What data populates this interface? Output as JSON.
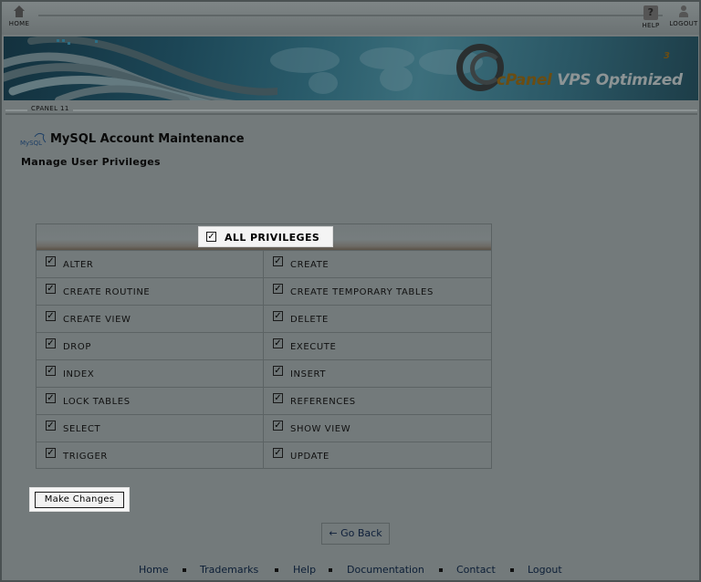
{
  "toolbar": {
    "home_label": "HOME",
    "help_label": "HELP",
    "logout_label": "LOGOUT"
  },
  "banner": {
    "brand_cpanel": "cPanel",
    "brand_rest": " VPS Optimized",
    "brand_version": "3"
  },
  "breadcrumb": {
    "label": "CPANEL 11"
  },
  "page": {
    "logo_text": "MySQL",
    "title": "MySQL Account Maintenance",
    "subtitle": "Manage User Privileges"
  },
  "privileges": {
    "all_label": "ALL PRIVILEGES",
    "all_checked": true,
    "rows": [
      [
        {
          "label": "ALTER",
          "checked": true
        },
        {
          "label": "CREATE",
          "checked": true
        }
      ],
      [
        {
          "label": "CREATE ROUTINE",
          "checked": true
        },
        {
          "label": "CREATE TEMPORARY TABLES",
          "checked": true
        }
      ],
      [
        {
          "label": "CREATE VIEW",
          "checked": true
        },
        {
          "label": "DELETE",
          "checked": true
        }
      ],
      [
        {
          "label": "DROP",
          "checked": true
        },
        {
          "label": "EXECUTE",
          "checked": true
        }
      ],
      [
        {
          "label": "INDEX",
          "checked": true
        },
        {
          "label": "INSERT",
          "checked": true
        }
      ],
      [
        {
          "label": "LOCK TABLES",
          "checked": true
        },
        {
          "label": "REFERENCES",
          "checked": true
        }
      ],
      [
        {
          "label": "SELECT",
          "checked": true
        },
        {
          "label": "SHOW VIEW",
          "checked": true
        }
      ],
      [
        {
          "label": "TRIGGER",
          "checked": true
        },
        {
          "label": "UPDATE",
          "checked": true
        }
      ]
    ]
  },
  "actions": {
    "make_changes_label": "Make Changes",
    "go_back_label": "← Go Back"
  },
  "footer": {
    "links": [
      "Home",
      "Trademarks",
      "Help",
      "Documentation",
      "Contact",
      "Logout"
    ]
  },
  "colors": {
    "background": "#737a7b",
    "banner_dark": "#13313e",
    "brand_accent": "#6b4d12",
    "link": "#0c1e36"
  }
}
